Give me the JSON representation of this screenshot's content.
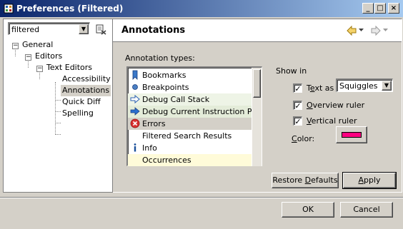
{
  "window": {
    "title": "Preferences (Filtered)",
    "controls": {
      "minimize": "_",
      "maximize": "□",
      "close": "×"
    }
  },
  "sidebar": {
    "filter_value": "filtered",
    "tree": [
      {
        "label": "General",
        "expanded": true
      },
      {
        "label": "Editors",
        "expanded": true
      },
      {
        "label": "Text Editors",
        "expanded": true
      },
      {
        "label": "Accessibility"
      },
      {
        "label": "Annotations",
        "selected": true
      },
      {
        "label": "Quick Diff"
      },
      {
        "label": "Spelling"
      }
    ]
  },
  "page": {
    "title": "Annotations",
    "annotation_types_label": "Annotation types:",
    "annotation_types": [
      {
        "label": "Bookmarks",
        "icon": "bookmark-icon"
      },
      {
        "label": "Breakpoints",
        "icon": "breakpoint-dot-icon"
      },
      {
        "label": "Debug Call Stack",
        "icon": "debug-arrow-icon",
        "bg": "#eef4e6"
      },
      {
        "label": "Debug Current Instruction Pointer",
        "icon": "debug-arrow-icon",
        "bg": "#e4ecd9"
      },
      {
        "label": "Errors",
        "icon": "error-icon",
        "selected": true
      },
      {
        "label": "Filtered Search Results",
        "icon": ""
      },
      {
        "label": "Info",
        "icon": "info-icon"
      },
      {
        "label": "Occurrences",
        "icon": "",
        "bg": "#fffbd9"
      }
    ],
    "show_in_label": "Show in",
    "text_as": {
      "prefix": "T",
      "underlined": "e",
      "suffix": "xt as",
      "checked": true,
      "style_value": "Squiggles"
    },
    "overview_ruler": {
      "underlined": "O",
      "suffix": "verview ruler",
      "checked": true
    },
    "vertical_ruler": {
      "underlined": "V",
      "suffix": "ertical ruler",
      "checked": true
    },
    "color": {
      "underlined": "C",
      "suffix": "olor:",
      "value": "#ff0080"
    }
  },
  "buttons": {
    "restore": {
      "prefix": "Restore ",
      "underlined": "D",
      "suffix": "efaults"
    },
    "apply": {
      "underlined": "A",
      "suffix": "pply"
    },
    "ok": "OK",
    "cancel": "Cancel"
  },
  "colors": {
    "title_gradient_start": "#0a246a",
    "title_gradient_end": "#a6caf0",
    "dialog_bg": "#d4d0c8",
    "selection_bg": "#d4d0c8"
  }
}
